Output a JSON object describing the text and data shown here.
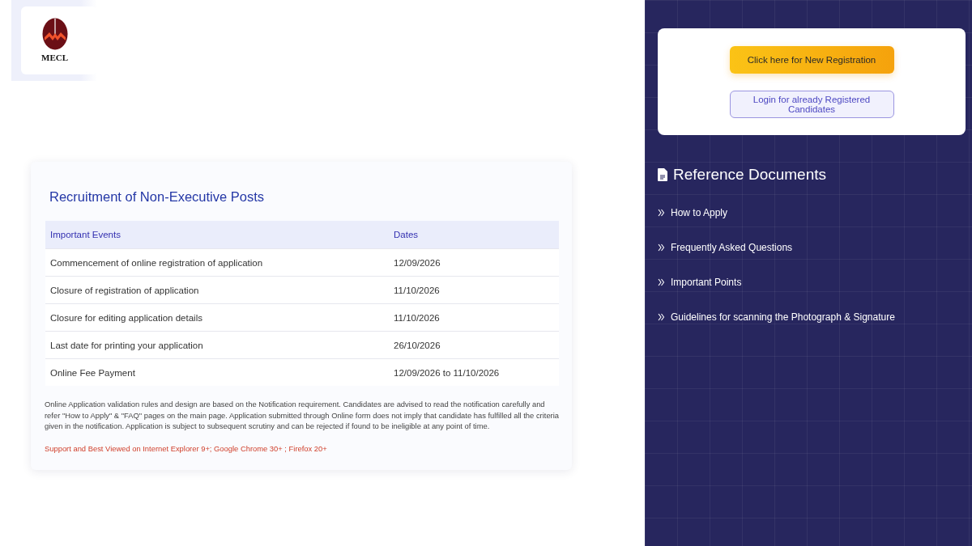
{
  "logo": {
    "text": "MECL"
  },
  "recruitment": {
    "title": "Recruitment of Non-Executive Posts",
    "columns": [
      "Important Events",
      "Dates"
    ],
    "rows": [
      {
        "event": "Commencement of online registration of application",
        "date": "12/09/2026"
      },
      {
        "event": "Closure of registration of application",
        "date": "11/10/2026"
      },
      {
        "event": "Closure for editing application details",
        "date": "11/10/2026"
      },
      {
        "event": "Last date for printing your application",
        "date": "26/10/2026"
      },
      {
        "event": "Online Fee Payment",
        "date": "12/09/2026 to 11/10/2026"
      }
    ],
    "note": "Online Application validation rules and design are based on the Notification requirement. Candidates are advised to read the notification carefully and refer \"How to Apply\" & \"FAQ\" pages on the main page. Application submitted through Online form does not imply that candidate has fulfilled all the criteria given in the notification. Application is subject to subsequent scrutiny and can be rejected if found to be ineligible at any point of time.",
    "browser_note": "Support and Best Viewed on Internet Explorer 9+; Google Chrome 30+ ; Firefox 20+"
  },
  "actions": [
    {
      "kind": "primary",
      "label": "Click here for New Registration"
    },
    {
      "kind": "secondary",
      "label": "Login for already Registered Candidates"
    }
  ],
  "reference": {
    "title": "Reference Documents",
    "items": [
      "How to Apply",
      "Frequently Asked Questions",
      "Important Points",
      "Guidelines for scanning the Photograph & Signature"
    ]
  }
}
